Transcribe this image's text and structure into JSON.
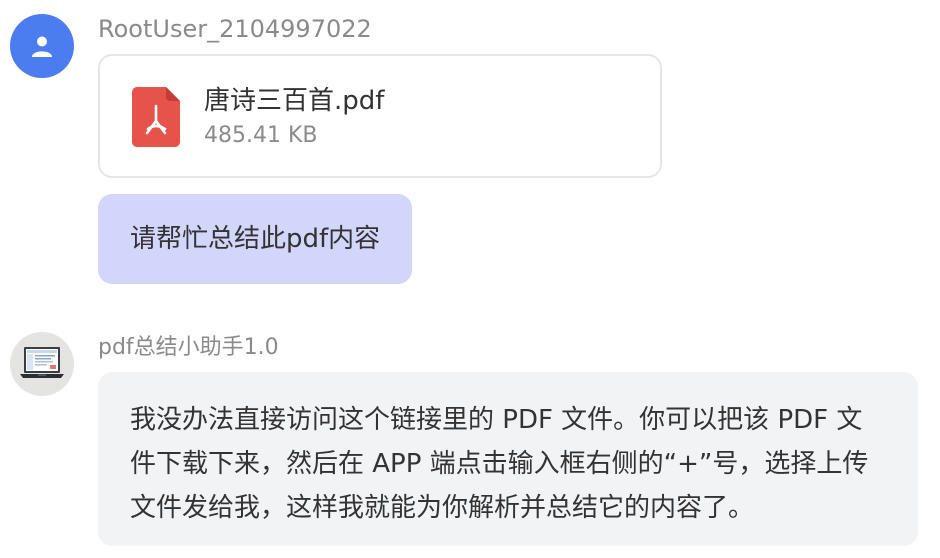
{
  "user_message": {
    "username": "RootUser_2104997022",
    "avatar_icon": "user-icon",
    "attachment": {
      "icon": "pdf-file-icon",
      "file_name": "唐诗三百首.pdf",
      "file_size": "485.41 KB"
    },
    "text": "请帮忙总结此pdf内容"
  },
  "bot_message": {
    "bot_name": "pdf总结小助手1.0",
    "avatar_icon": "laptop-icon",
    "text": "我没办法直接访问这个链接里的 PDF 文件。你可以把该 PDF 文件下载下来，然后在 APP 端点击输入框右侧的“+”号，选择上传文件发给我，这样我就能为你解析并总结它的内容了。"
  },
  "colors": {
    "user_avatar_bg": "#4C7DF0",
    "user_bubble_bg": "#D2D6FA",
    "bot_bubble_bg": "#F2F3F5",
    "pdf_icon_red": "#E5534B"
  }
}
